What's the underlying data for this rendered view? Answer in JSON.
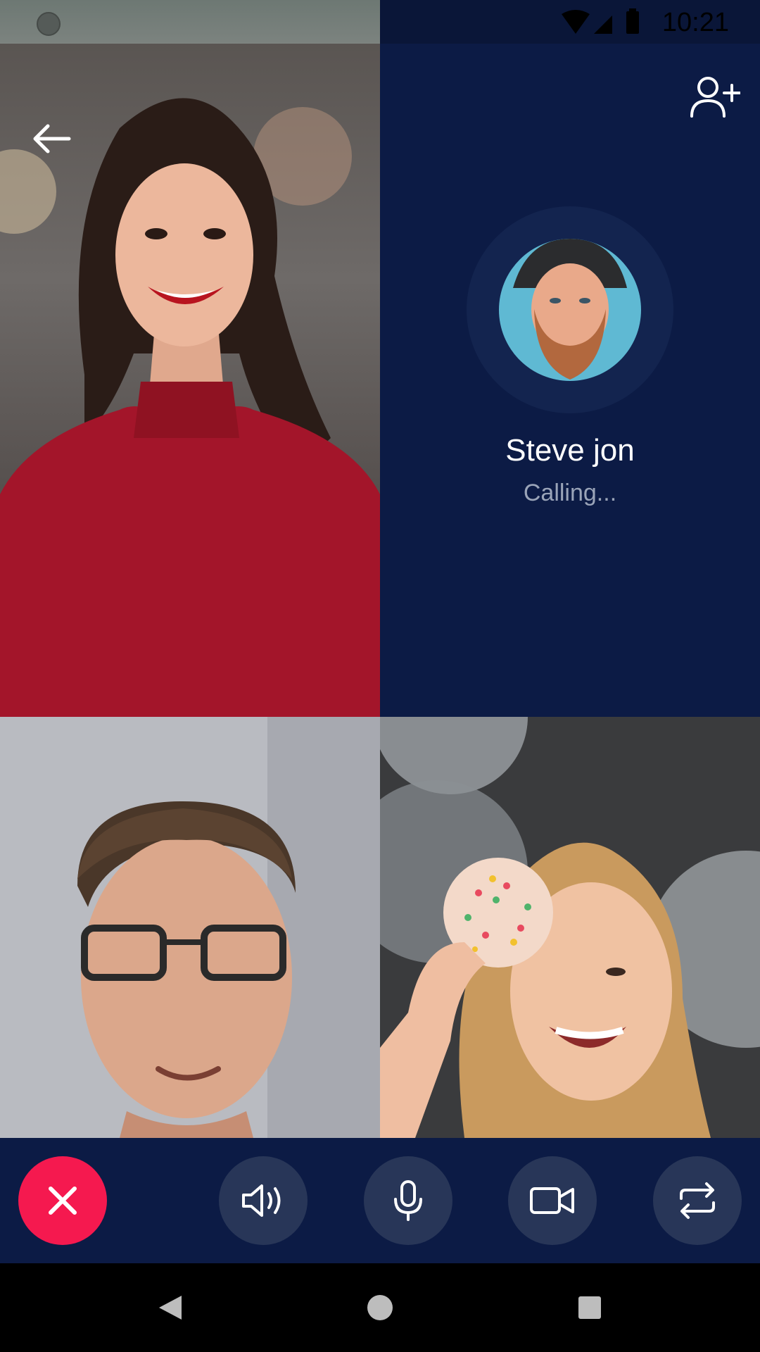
{
  "status_bar": {
    "time": "10:21"
  },
  "call": {
    "caller_name": "Steve jon",
    "call_status": "Calling..."
  },
  "colors": {
    "background": "#0c1b45",
    "end_call": "#f5194f",
    "control_button": "#283658",
    "status_text": "#9aa4b8"
  },
  "header": {
    "back_icon": "arrow-left-icon",
    "add_participant_icon": "add-person-icon"
  },
  "controls": [
    {
      "icon": "close-icon",
      "action": "end-call"
    },
    {
      "icon": "speaker-icon",
      "action": "speaker"
    },
    {
      "icon": "microphone-icon",
      "action": "mute"
    },
    {
      "icon": "video-camera-icon",
      "action": "video"
    },
    {
      "icon": "switch-camera-icon",
      "action": "switch-camera"
    }
  ],
  "nav": {
    "back_icon": "triangle-back-icon",
    "home_icon": "circle-home-icon",
    "recent_icon": "square-recent-icon"
  }
}
